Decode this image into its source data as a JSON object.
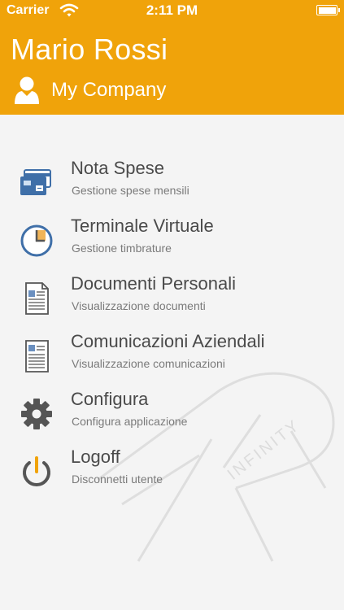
{
  "status_bar": {
    "carrier": "Carrier",
    "time": "2:11 PM",
    "wifi_icon": "wifi-icon",
    "battery_icon": "battery-icon"
  },
  "header": {
    "user_name": "Mario Rossi",
    "company": "My Company",
    "icon": "person-icon",
    "color": "#f0a30a"
  },
  "menu": {
    "items": [
      {
        "title": "Nota Spese",
        "subtitle": "Gestione spese mensili",
        "icon": "wallet-cards-icon"
      },
      {
        "title": "Terminale Virtuale",
        "subtitle": "Gestione timbrature",
        "icon": "clock-icon"
      },
      {
        "title": "Documenti Personali",
        "subtitle": "Visualizzazione documenti",
        "icon": "document-icon"
      },
      {
        "title": "Comunicazioni Aziendali",
        "subtitle": "Visualizzazione comunicazioni",
        "icon": "document-icon"
      },
      {
        "title": "Configura",
        "subtitle": "Configura applicazione",
        "icon": "gear-icon"
      },
      {
        "title": "Logoff",
        "subtitle": "Disconnetti utente",
        "icon": "power-icon"
      }
    ]
  },
  "watermark": {
    "text": "INFINITY"
  }
}
